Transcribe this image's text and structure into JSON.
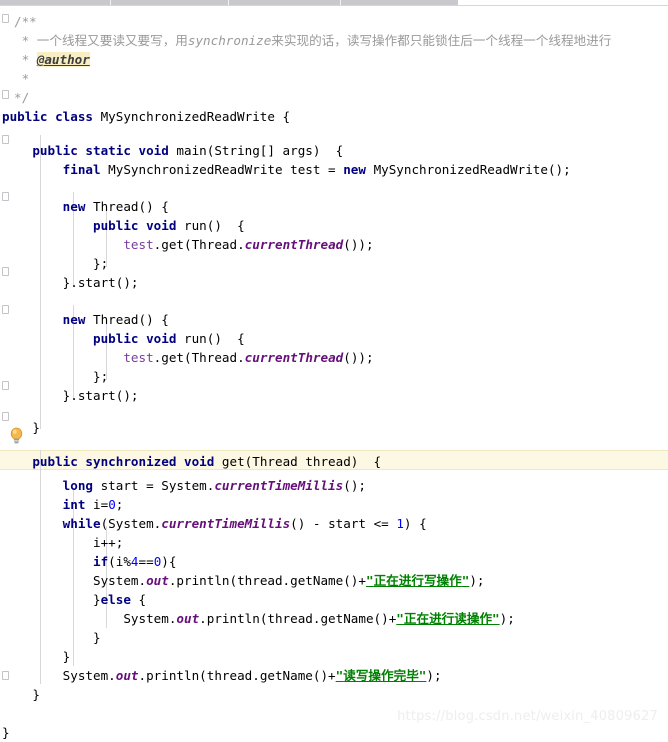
{
  "app": {
    "kind": "java-code-editor",
    "theme": "light",
    "file_language": "Java"
  },
  "tab_strip": {
    "visible": true,
    "fill_color": "#c9c9cd",
    "divider_positions": [
      110,
      228,
      340
    ]
  },
  "gutter": {
    "fold_marker_label": "fold-marker",
    "bulb_tooltip": "Show Intention Actions",
    "bulb_color": "#f0a830"
  },
  "highlight": {
    "current_line_color": "#fdf8e3",
    "current_line_text": "public synchronized void get(Thread thread)  {"
  },
  "colors": {
    "keyword": "#000080",
    "string": "#008000",
    "number": "#0000ff",
    "static_field": "#660e7a",
    "comment": "#9a9a9a",
    "javadoc_tag_bg": "#f7eec4",
    "local_var": "#7a3e9d",
    "background": "#ffffff",
    "indent_guide": "#d8d8dc"
  },
  "watermark": {
    "text": "https://blog.csdn.net/weixin_40809627"
  },
  "code": {
    "class_name": "MySynchronizedReadWrite",
    "javadoc": {
      "open": "/**",
      "description": "一个线程又要读又要写，用synchronize来实现的话，读写操作都只能锁住后一个线程一个线程地进行",
      "description_plain_head": "一个线程又要读又要写，用",
      "description_italic": "synchronize",
      "description_plain_tail": "来实现的话，读写操作都只能锁住后一个线程一个线程地进行",
      "author_tag": "@author",
      "close": "*/"
    },
    "strings": {
      "writing": "正在进行写操作",
      "reading": "正在进行读操作",
      "done": "读写操作完毕"
    },
    "lines": [
      "/**",
      " * 一个线程又要读又要写，用synchronize来实现的话，读写操作都只能锁住后一个线程一个线程地进行",
      " * @author",
      " *",
      " */",
      "public class MySynchronizedReadWrite {",
      "",
      "    public static void main(String[] args)  {",
      "        final MySynchronizedReadWrite test = new MySynchronizedReadWrite();",
      "",
      "        new Thread() {",
      "            public void run()  {",
      "                test.get(Thread.currentThread());",
      "            };",
      "        }.start();",
      "",
      "        new Thread() {",
      "            public void run()  {",
      "                test.get(Thread.currentThread());",
      "            };",
      "        }.start();",
      "",
      "    }",
      "",
      "    public synchronized void get(Thread thread)  {",
      "        long start = System.currentTimeMillis();",
      "        int i=0;",
      "        while(System.currentTimeMillis() - start <= 1) {",
      "            i++;",
      "            if(i%4==0){",
      "            System.out.println(thread.getName()+\"正在进行写操作\");",
      "            }else {",
      "                System.out.println(thread.getName()+\"正在进行读操作\");",
      "            }",
      "        }",
      "        System.out.println(thread.getName()+\"读写操作完毕\");",
      "    }",
      "",
      "",
      "}"
    ]
  }
}
